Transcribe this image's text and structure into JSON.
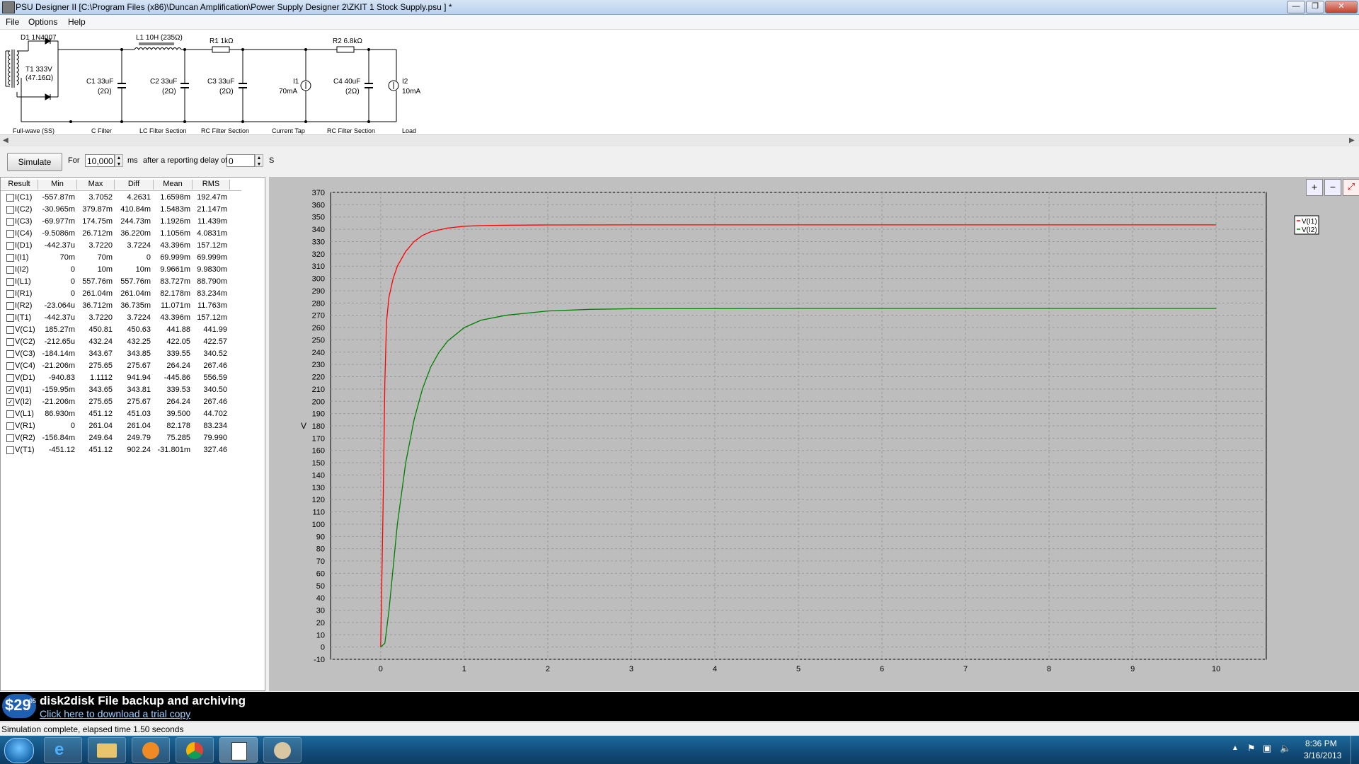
{
  "window": {
    "title": "PSU Designer II  [C:\\Program Files (x86)\\Duncan Amplification\\Power Supply Designer 2\\ZKIT 1 Stock Supply.psu ] *",
    "min_glyph": "—",
    "max_glyph": "❐",
    "close_glyph": "✕"
  },
  "menu": {
    "file": "File",
    "options": "Options",
    "help": "Help"
  },
  "schematic": {
    "d1": "D1 1N4007",
    "t1_a": "T1 333V",
    "t1_b": "(47.16Ω)",
    "c1_a": "C1 33uF",
    "c1_b": "(2Ω)",
    "l1": "L1 10H (235Ω)",
    "c2_a": "C2 33uF",
    "c2_b": "(2Ω)",
    "r1": "R1 1kΩ",
    "c3_a": "C3 33uF",
    "c3_b": "(2Ω)",
    "i1_a": "I1",
    "i1_b": "70mA",
    "r2": "R2 6.8kΩ",
    "c4_a": "C4 40uF",
    "c4_b": "(2Ω)",
    "i2_a": "I2",
    "i2_b": "10mA",
    "sections": [
      "Full-wave (SS)",
      "C Filter",
      "LC Filter Section",
      "RC Filter Section",
      "Current Tap",
      "RC Filter Section",
      "Load"
    ]
  },
  "sim": {
    "button": "Simulate",
    "for_label": "For",
    "duration": "10,000",
    "ms_label": "ms",
    "delay_label": "after a reporting delay of",
    "delay": "0",
    "s_label": "S"
  },
  "results": {
    "headers": [
      "Result",
      "Min",
      "Max",
      "Diff",
      "Mean",
      "RMS"
    ],
    "rows": [
      {
        "name": "I(C1)",
        "min": "-557.87m",
        "max": "3.7052",
        "diff": "4.2631",
        "mean": "1.6598m",
        "rms": "192.47m",
        "checked": false
      },
      {
        "name": "I(C2)",
        "min": "-30.965m",
        "max": "379.87m",
        "diff": "410.84m",
        "mean": "1.5483m",
        "rms": "21.147m",
        "checked": false
      },
      {
        "name": "I(C3)",
        "min": "-69.977m",
        "max": "174.75m",
        "diff": "244.73m",
        "mean": "1.1926m",
        "rms": "11.439m",
        "checked": false
      },
      {
        "name": "I(C4)",
        "min": "-9.5086m",
        "max": "26.712m",
        "diff": "36.220m",
        "mean": "1.1056m",
        "rms": "4.0831m",
        "checked": false
      },
      {
        "name": "I(D1)",
        "min": "-442.37u",
        "max": "3.7220",
        "diff": "3.7224",
        "mean": "43.396m",
        "rms": "157.12m",
        "checked": false
      },
      {
        "name": "I(I1)",
        "min": "70m",
        "max": "70m",
        "diff": "0",
        "mean": "69.999m",
        "rms": "69.999m",
        "checked": false
      },
      {
        "name": "I(I2)",
        "min": "0",
        "max": "10m",
        "diff": "10m",
        "mean": "9.9661m",
        "rms": "9.9830m",
        "checked": false
      },
      {
        "name": "I(L1)",
        "min": "0",
        "max": "557.76m",
        "diff": "557.76m",
        "mean": "83.727m",
        "rms": "88.790m",
        "checked": false
      },
      {
        "name": "I(R1)",
        "min": "0",
        "max": "261.04m",
        "diff": "261.04m",
        "mean": "82.178m",
        "rms": "83.234m",
        "checked": false
      },
      {
        "name": "I(R2)",
        "min": "-23.064u",
        "max": "36.712m",
        "diff": "36.735m",
        "mean": "11.071m",
        "rms": "11.763m",
        "checked": false
      },
      {
        "name": "I(T1)",
        "min": "-442.37u",
        "max": "3.7220",
        "diff": "3.7224",
        "mean": "43.396m",
        "rms": "157.12m",
        "checked": false
      },
      {
        "name": "V(C1)",
        "min": "185.27m",
        "max": "450.81",
        "diff": "450.63",
        "mean": "441.88",
        "rms": "441.99",
        "checked": false
      },
      {
        "name": "V(C2)",
        "min": "-212.65u",
        "max": "432.24",
        "diff": "432.25",
        "mean": "422.05",
        "rms": "422.57",
        "checked": false
      },
      {
        "name": "V(C3)",
        "min": "-184.14m",
        "max": "343.67",
        "diff": "343.85",
        "mean": "339.55",
        "rms": "340.52",
        "checked": false
      },
      {
        "name": "V(C4)",
        "min": "-21.206m",
        "max": "275.65",
        "diff": "275.67",
        "mean": "264.24",
        "rms": "267.46",
        "checked": false
      },
      {
        "name": "V(D1)",
        "min": "-940.83",
        "max": "1.1112",
        "diff": "941.94",
        "mean": "-445.86",
        "rms": "556.59",
        "checked": false
      },
      {
        "name": "V(I1)",
        "min": "-159.95m",
        "max": "343.65",
        "diff": "343.81",
        "mean": "339.53",
        "rms": "340.50",
        "checked": true
      },
      {
        "name": "V(I2)",
        "min": "-21.206m",
        "max": "275.65",
        "diff": "275.67",
        "mean": "264.24",
        "rms": "267.46",
        "checked": true
      },
      {
        "name": "V(L1)",
        "min": "86.930m",
        "max": "451.12",
        "diff": "451.03",
        "mean": "39.500",
        "rms": "44.702",
        "checked": false
      },
      {
        "name": "V(R1)",
        "min": "0",
        "max": "261.04",
        "diff": "261.04",
        "mean": "82.178",
        "rms": "83.234",
        "checked": false
      },
      {
        "name": "V(R2)",
        "min": "-156.84m",
        "max": "249.64",
        "diff": "249.79",
        "mean": "75.285",
        "rms": "79.990",
        "checked": false
      },
      {
        "name": "V(T1)",
        "min": "-451.12",
        "max": "451.12",
        "diff": "902.24",
        "mean": "-31.801m",
        "rms": "327.46",
        "checked": false
      }
    ]
  },
  "chart_data": {
    "type": "line",
    "ylabel": "V",
    "xlim": [
      -0.6,
      10.6
    ],
    "ylim": [
      -10,
      370
    ],
    "x_ticks": [
      0,
      1,
      2,
      3,
      4,
      5,
      6,
      7,
      8,
      9,
      10
    ],
    "y_ticks": [
      -10,
      0,
      10,
      20,
      30,
      40,
      50,
      60,
      70,
      80,
      90,
      100,
      110,
      120,
      130,
      140,
      150,
      160,
      170,
      180,
      190,
      200,
      210,
      220,
      230,
      240,
      250,
      260,
      270,
      280,
      290,
      300,
      310,
      320,
      330,
      340,
      350,
      360,
      370
    ],
    "grid": true,
    "legend_position": "top-right",
    "series": [
      {
        "name": "V(I1)",
        "color": "#ff0000",
        "x": [
          0,
          0.03,
          0.05,
          0.07,
          0.1,
          0.15,
          0.2,
          0.3,
          0.4,
          0.5,
          0.6,
          0.8,
          1.0,
          1.2,
          1.5,
          2.0,
          3.0,
          5.0,
          7.0,
          10.0
        ],
        "y": [
          0,
          120,
          215,
          265,
          285,
          300,
          310,
          322,
          330,
          335,
          338,
          341,
          342.5,
          343,
          343.3,
          343.5,
          343.6,
          343.6,
          343.6,
          343.6
        ]
      },
      {
        "name": "V(I2)",
        "color": "#008000",
        "x": [
          0,
          0.05,
          0.1,
          0.15,
          0.2,
          0.3,
          0.4,
          0.5,
          0.6,
          0.7,
          0.8,
          1.0,
          1.2,
          1.5,
          2.0,
          2.5,
          3.0,
          5.0,
          7.0,
          10.0
        ],
        "y": [
          0,
          3,
          30,
          65,
          100,
          150,
          185,
          210,
          228,
          240,
          249,
          260,
          266,
          270,
          273.5,
          274.8,
          275.3,
          275.6,
          275.6,
          275.6
        ]
      }
    ]
  },
  "zoom": {
    "in": "+",
    "out": "−",
    "reset": "⤢"
  },
  "ad": {
    "price": "$29",
    "cents": "95",
    "title": "disk2disk File backup and archiving",
    "link": "Click here to download a trial copy"
  },
  "status": "Simulation complete, elapsed time 1.50 seconds",
  "taskbar": {
    "time": "8:36 PM",
    "date": "3/16/2013"
  }
}
